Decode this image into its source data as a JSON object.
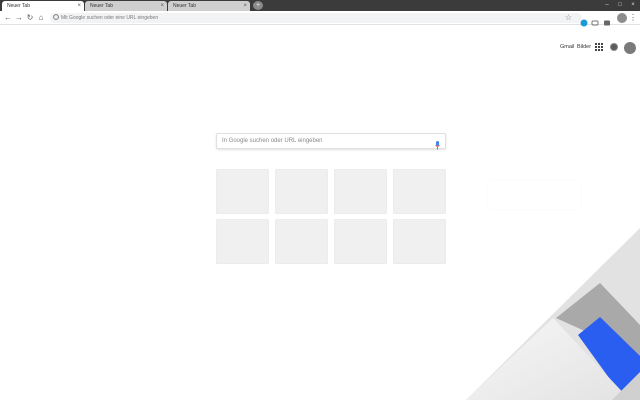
{
  "tabs": [
    {
      "label": "Neuer Tab",
      "active": true
    },
    {
      "label": "Neuer Tab",
      "active": false
    },
    {
      "label": "Neuer Tab",
      "active": false
    }
  ],
  "tab_close_glyph": "×",
  "new_tab_glyph": "+",
  "window_controls": {
    "minimize": "–",
    "maximize": "□",
    "close": "×"
  },
  "toolbar": {
    "back_glyph": "←",
    "forward_glyph": "→",
    "reload_glyph": "↻",
    "home_glyph": "⌂",
    "omnibox_placeholder": "Mit Google suchen oder eine URL eingeben",
    "star_glyph": "☆",
    "menu_glyph": "⋮"
  },
  "header": {
    "gmail_label": "Gmail",
    "images_label": "Bilder"
  },
  "search": {
    "placeholder": "In Google suchen oder URL eingeben"
  },
  "shortcut_tiles": 8,
  "colors": {
    "tab_strip": "#3b3b3b",
    "accent_blue": "#2a5ef0",
    "corner_grey": "#a7a7a7",
    "tile_bg": "#f0f0f0"
  }
}
